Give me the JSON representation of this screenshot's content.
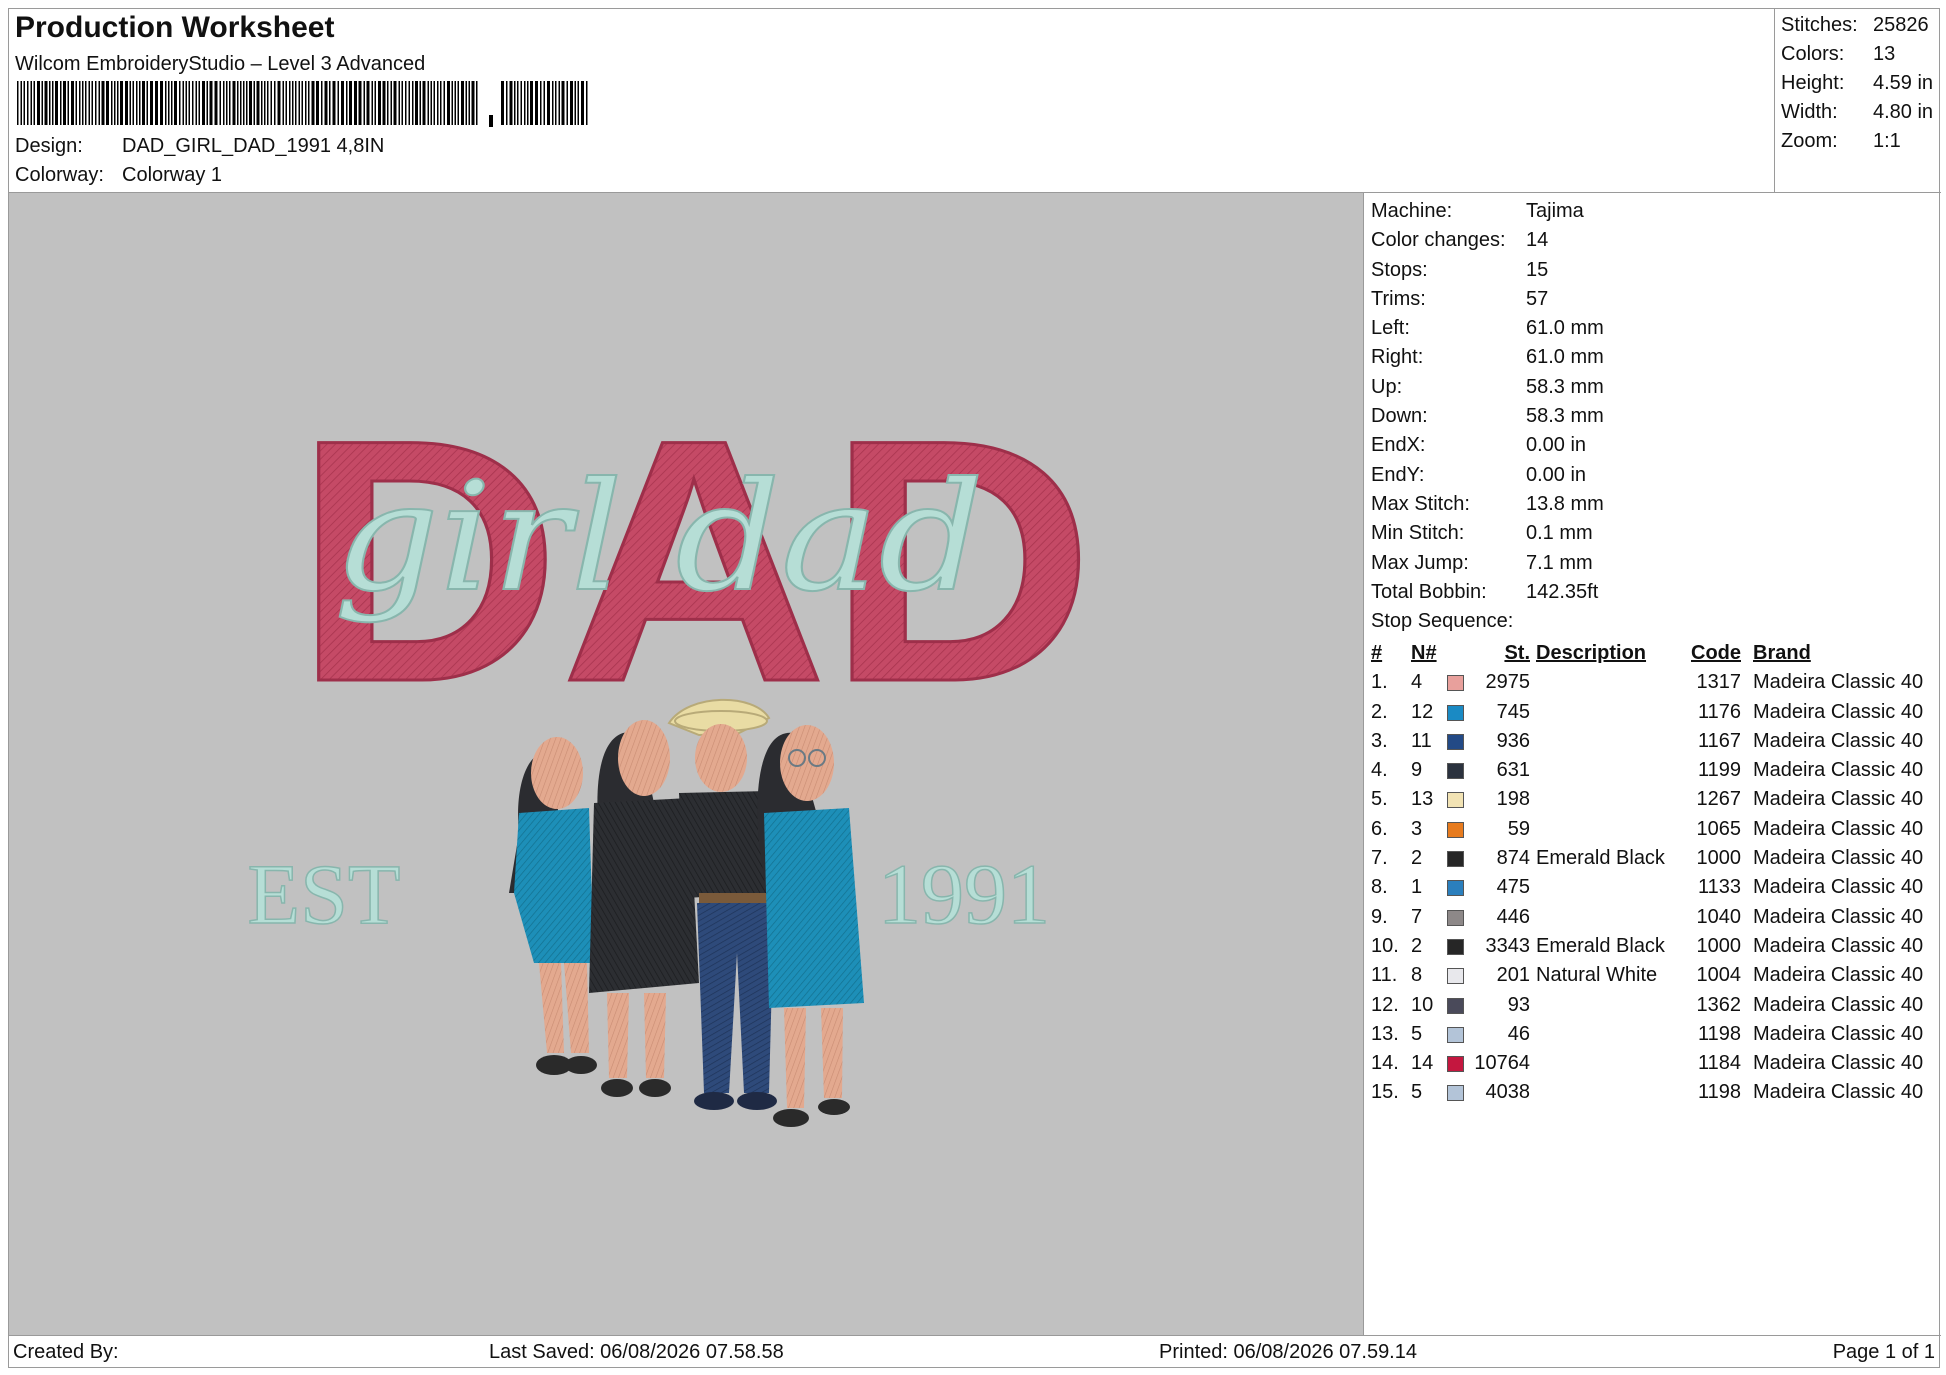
{
  "header": {
    "title": "Production Worksheet",
    "software": "Wilcom EmbroideryStudio – Level 3 Advanced",
    "design_label": "Design:",
    "design_value": "DAD_GIRL_DAD_1991 4,8IN",
    "colorway_label": "Colorway:",
    "colorway_value": "Colorway 1"
  },
  "stats": [
    {
      "label": "Stitches:",
      "value": "25826"
    },
    {
      "label": "Colors:",
      "value": "13"
    },
    {
      "label": "Height:",
      "value": "4.59 in"
    },
    {
      "label": "Width:",
      "value": "4.80 in"
    },
    {
      "label": "Zoom:",
      "value": "1:1"
    }
  ],
  "machine_info": [
    {
      "label": "Machine:",
      "value": "Tajima"
    },
    {
      "label": "Color changes:",
      "value": "14"
    },
    {
      "label": "Stops:",
      "value": "15"
    },
    {
      "label": "Trims:",
      "value": "57"
    },
    {
      "label": "Left:",
      "value": "61.0 mm"
    },
    {
      "label": "Right:",
      "value": "61.0 mm"
    },
    {
      "label": "Up:",
      "value": "58.3 mm"
    },
    {
      "label": "Down:",
      "value": "58.3 mm"
    },
    {
      "label": "EndX:",
      "value": "0.00 in"
    },
    {
      "label": "EndY:",
      "value": "0.00 in"
    },
    {
      "label": "Max Stitch:",
      "value": "13.8 mm"
    },
    {
      "label": "Min Stitch:",
      "value": "0.1 mm"
    },
    {
      "label": "Max Jump:",
      "value": "7.1 mm"
    },
    {
      "label": "Total Bobbin:",
      "value": "142.35ft"
    },
    {
      "label": "Stop Sequence:",
      "value": ""
    }
  ],
  "sequence_headers": {
    "idx": "#",
    "n": "N#",
    "st": "St.",
    "desc": "Description",
    "code": "Code",
    "brand": "Brand"
  },
  "sequence": [
    {
      "idx": "1.",
      "n": "4",
      "color": "#e8a09c",
      "st": "2975",
      "desc": "",
      "code": "1317",
      "brand": "Madeira Classic 40"
    },
    {
      "idx": "2.",
      "n": "12",
      "color": "#1a8ac4",
      "st": "745",
      "desc": "",
      "code": "1176",
      "brand": "Madeira Classic 40"
    },
    {
      "idx": "3.",
      "n": "11",
      "color": "#234a86",
      "st": "936",
      "desc": "",
      "code": "1167",
      "brand": "Madeira Classic 40"
    },
    {
      "idx": "4.",
      "n": "9",
      "color": "#2b323e",
      "st": "631",
      "desc": "",
      "code": "1199",
      "brand": "Madeira Classic 40"
    },
    {
      "idx": "5.",
      "n": "13",
      "color": "#f2e3b4",
      "st": "198",
      "desc": "",
      "code": "1267",
      "brand": "Madeira Classic 40"
    },
    {
      "idx": "6.",
      "n": "3",
      "color": "#e77b1e",
      "st": "59",
      "desc": "",
      "code": "1065",
      "brand": "Madeira Classic 40"
    },
    {
      "idx": "7.",
      "n": "2",
      "color": "#262626",
      "st": "874",
      "desc": "Emerald Black",
      "code": "1000",
      "brand": "Madeira Classic 40"
    },
    {
      "idx": "8.",
      "n": "1",
      "color": "#2b7fbd",
      "st": "475",
      "desc": "",
      "code": "1133",
      "brand": "Madeira Classic 40"
    },
    {
      "idx": "9.",
      "n": "7",
      "color": "#8d8888",
      "st": "446",
      "desc": "",
      "code": "1040",
      "brand": "Madeira Classic 40"
    },
    {
      "idx": "10.",
      "n": "2",
      "color": "#262626",
      "st": "3343",
      "desc": "Emerald Black",
      "code": "1000",
      "brand": "Madeira Classic 40"
    },
    {
      "idx": "11.",
      "n": "8",
      "color": "#e8e8ec",
      "st": "201",
      "desc": "Natural White",
      "code": "1004",
      "brand": "Madeira Classic 40"
    },
    {
      "idx": "12.",
      "n": "10",
      "color": "#4a4a5a",
      "st": "93",
      "desc": "",
      "code": "1362",
      "brand": "Madeira Classic 40"
    },
    {
      "idx": "13.",
      "n": "5",
      "color": "#b3c4d8",
      "st": "46",
      "desc": "",
      "code": "1198",
      "brand": "Madeira Classic 40"
    },
    {
      "idx": "14.",
      "n": "14",
      "color": "#c4173f",
      "st": "10764",
      "desc": "",
      "code": "1184",
      "brand": "Madeira Classic 40"
    },
    {
      "idx": "15.",
      "n": "5",
      "color": "#b3c4d8",
      "st": "4038",
      "desc": "",
      "code": "1198",
      "brand": "Madeira Classic 40"
    }
  ],
  "design_preview": {
    "dad_text": "DAD",
    "script_text": "girl dad",
    "est_text": "EST",
    "year_text": "1991",
    "dad_color": "#c54a66",
    "script_color": "#b6ded6",
    "bg_color": "#c1c1c1"
  },
  "footer": {
    "created_by": "Created By:",
    "last_saved": "Last Saved: 06/08/2026 07.58.58",
    "printed": "Printed: 06/08/2026 07.59.14",
    "page": "Page 1 of 1"
  }
}
